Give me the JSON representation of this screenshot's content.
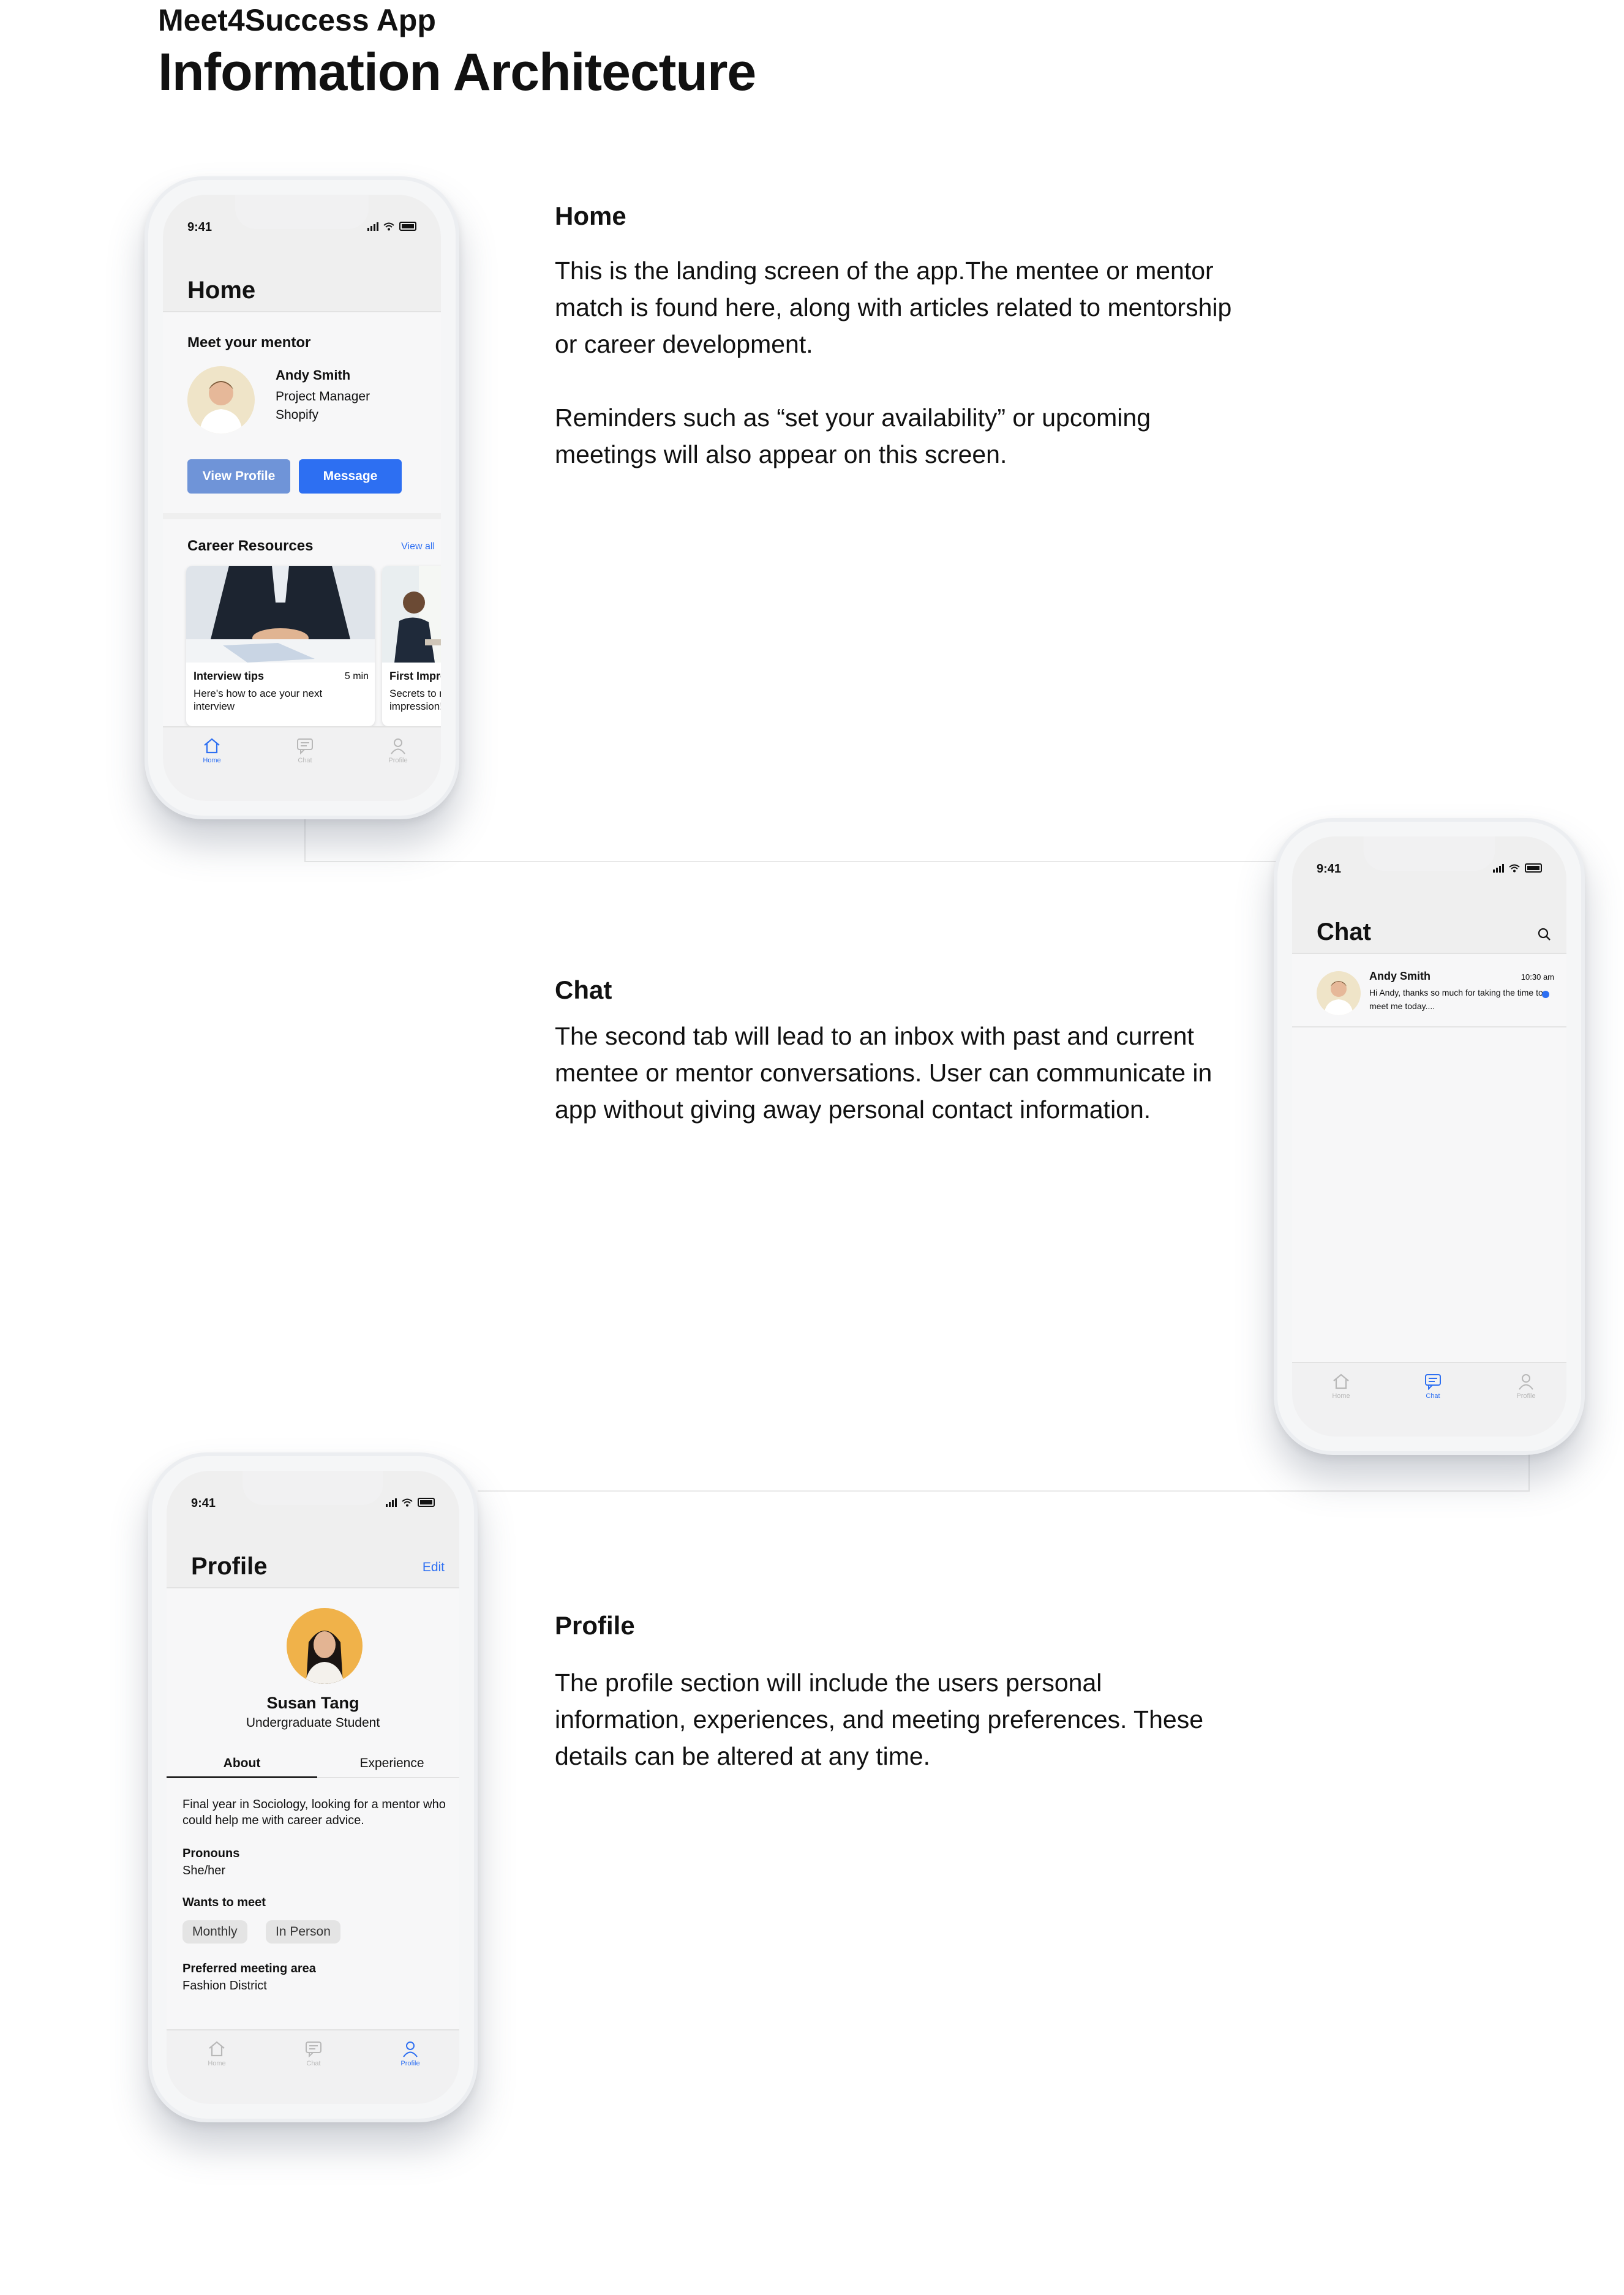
{
  "header": {
    "app_name": "Meet4Success App",
    "title": "Information Architecture"
  },
  "sections": {
    "home": {
      "title": "Home",
      "paragraph1": "This is the landing screen of the app.The mentee or mentor match is found here, along with articles related to mentorship or career development.",
      "paragraph2": "Reminders such as “set your availability” or upcoming meetings will also appear on this screen."
    },
    "chat": {
      "title": "Chat",
      "paragraph1": "The second tab will lead to an inbox with past and current mentee or mentor conversations. User can communicate in app without giving away personal contact information."
    },
    "profile": {
      "title": "Profile",
      "paragraph1": "The profile section will include the users personal information, experiences, and meeting preferences. These details can be altered at any time."
    }
  },
  "status_time": "9:41",
  "tabs": {
    "home": "Home",
    "chat": "Chat",
    "profile": "Profile"
  },
  "home_screen": {
    "title": "Home",
    "mentor_heading": "Meet your mentor",
    "mentor_name": "Andy Smith",
    "mentor_role": "Project Manager",
    "mentor_company": "Shopify",
    "view_profile": "View Profile",
    "message": "Message",
    "resources_heading": "Career Resources",
    "view_all": "View all",
    "card1_title": "Interview tips",
    "card1_time": "5 min",
    "card1_sub": "Here's how to ace your next interview",
    "card2_title": "First Impress",
    "card2_sub": "Secrets to ma impression!"
  },
  "chat_screen": {
    "title": "Chat",
    "conv_name": "Andy Smith",
    "conv_time": "10:30 am",
    "conv_preview": "Hi Andy, thanks so much for taking the time to meet me today...."
  },
  "profile_screen": {
    "title": "Profile",
    "edit": "Edit",
    "name": "Susan Tang",
    "subtitle": "Undergraduate Student",
    "tab_about": "About",
    "tab_experience": "Experience",
    "bio": "Final year in Sociology, looking for a mentor who could help me with career advice.",
    "pronouns_label": "Pronouns",
    "pronouns_value": "She/her",
    "wants_label": "Wants to meet",
    "pill1": "Monthly",
    "pill2": "In Person",
    "area_label": "Preferred meeting area",
    "area_value": "Fashion District"
  },
  "colors": {
    "accent": "#2d6ff2",
    "muted_button": "#6f94d8",
    "avatar_orange": "#f0b24a"
  }
}
